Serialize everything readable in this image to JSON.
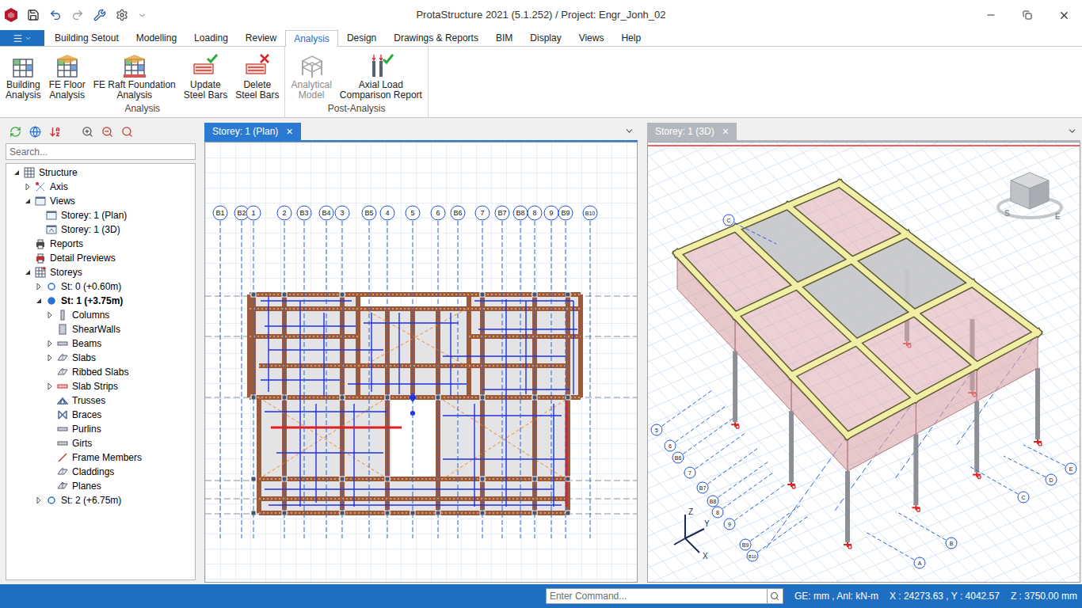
{
  "window": {
    "title": "ProtaStructure 2021 (5.1.252) / Project: Engr_Jonh_02"
  },
  "ribbon_tabs": [
    {
      "label": "Building Setout",
      "selected": false
    },
    {
      "label": "Modelling",
      "selected": false
    },
    {
      "label": "Loading",
      "selected": false
    },
    {
      "label": "Review",
      "selected": false
    },
    {
      "label": "Analysis",
      "selected": true
    },
    {
      "label": "Design",
      "selected": false
    },
    {
      "label": "Drawings & Reports",
      "selected": false
    },
    {
      "label": "BIM",
      "selected": false
    },
    {
      "label": "Display",
      "selected": false
    },
    {
      "label": "Views",
      "selected": false
    },
    {
      "label": "Help",
      "selected": false
    }
  ],
  "ribbon_groups": [
    {
      "label": "Analysis",
      "buttons": [
        {
          "lines": [
            "Building",
            "Analysis"
          ],
          "disabled": false
        },
        {
          "lines": [
            "FE Floor",
            "Analysis"
          ],
          "disabled": false
        },
        {
          "lines": [
            "FE Raft Foundation",
            "Analysis"
          ],
          "disabled": false
        },
        {
          "lines": [
            "Update",
            "Steel Bars"
          ],
          "disabled": false
        },
        {
          "lines": [
            "Delete",
            "Steel Bars"
          ],
          "disabled": false
        }
      ]
    },
    {
      "label": "Post-Analysis",
      "buttons": [
        {
          "lines": [
            "Analytical",
            "Model"
          ],
          "disabled": true
        },
        {
          "lines": [
            "Axial Load",
            "Comparison Report"
          ],
          "disabled": false
        }
      ]
    }
  ],
  "explorer": {
    "search_placeholder": "Search...",
    "tree": [
      {
        "label": "Structure",
        "depth": 0,
        "expandable": true,
        "expanded": true,
        "current": false
      },
      {
        "label": "Axis",
        "depth": 1,
        "expandable": true,
        "expanded": false,
        "current": false
      },
      {
        "label": "Views",
        "depth": 1,
        "expandable": true,
        "expanded": true,
        "current": false
      },
      {
        "label": "Storey: 1 (Plan)",
        "depth": 2,
        "expandable": false,
        "expanded": false,
        "current": false
      },
      {
        "label": "Storey: 1 (3D)",
        "depth": 2,
        "expandable": false,
        "expanded": false,
        "current": false
      },
      {
        "label": "Reports",
        "depth": 1,
        "expandable": false,
        "expanded": false,
        "current": false
      },
      {
        "label": "Detail Previews",
        "depth": 1,
        "expandable": false,
        "expanded": false,
        "current": false
      },
      {
        "label": "Storeys",
        "depth": 1,
        "expandable": true,
        "expanded": true,
        "current": false
      },
      {
        "label": "St: 0 (+0.60m)",
        "depth": 2,
        "expandable": true,
        "expanded": false,
        "current": false
      },
      {
        "label": "St: 1 (+3.75m)",
        "depth": 2,
        "expandable": true,
        "expanded": true,
        "current": true
      },
      {
        "label": "Columns",
        "depth": 3,
        "expandable": true,
        "expanded": false,
        "current": false
      },
      {
        "label": "ShearWalls",
        "depth": 3,
        "expandable": false,
        "expanded": false,
        "current": false
      },
      {
        "label": "Beams",
        "depth": 3,
        "expandable": true,
        "expanded": false,
        "current": false
      },
      {
        "label": "Slabs",
        "depth": 3,
        "expandable": true,
        "expanded": false,
        "current": false
      },
      {
        "label": "Ribbed Slabs",
        "depth": 3,
        "expandable": false,
        "expanded": false,
        "current": false
      },
      {
        "label": "Slab Strips",
        "depth": 3,
        "expandable": true,
        "expanded": false,
        "current": false
      },
      {
        "label": "Trusses",
        "depth": 3,
        "expandable": false,
        "expanded": false,
        "current": false
      },
      {
        "label": "Braces",
        "depth": 3,
        "expandable": false,
        "expanded": false,
        "current": false
      },
      {
        "label": "Purlins",
        "depth": 3,
        "expandable": false,
        "expanded": false,
        "current": false
      },
      {
        "label": "Girts",
        "depth": 3,
        "expandable": false,
        "expanded": false,
        "current": false
      },
      {
        "label": "Frame Members",
        "depth": 3,
        "expandable": false,
        "expanded": false,
        "current": false
      },
      {
        "label": "Claddings",
        "depth": 3,
        "expandable": false,
        "expanded": false,
        "current": false
      },
      {
        "label": "Planes",
        "depth": 3,
        "expandable": false,
        "expanded": false,
        "current": false
      },
      {
        "label": "St: 2 (+6.75m)",
        "depth": 2,
        "expandable": true,
        "expanded": false,
        "current": false
      }
    ]
  },
  "views": [
    {
      "tab": "Storey: 1 (Plan)",
      "close": "×",
      "selected": true,
      "kind": "plan",
      "axes": [
        "B1",
        "B2",
        "1",
        "2",
        "B3",
        "B4",
        "3",
        "B5",
        "4",
        "5",
        "6",
        "B6",
        "7",
        "B7",
        "B8",
        "8",
        "9",
        "B9",
        "B10"
      ]
    },
    {
      "tab": "Storey: 1 (3D)",
      "close": "×",
      "selected": false,
      "kind": "3d",
      "axes": [
        "5",
        "6",
        "B6",
        "7",
        "B7",
        "B8",
        "8",
        "9",
        "B9",
        "B10",
        "C",
        "B",
        "A",
        "D",
        "E",
        "C"
      ],
      "compass": [
        "S",
        "E"
      ],
      "triad": [
        "Z",
        "Y",
        "X"
      ]
    }
  ],
  "status_bar": {
    "command_placeholder": "Enter Command...",
    "units": "GE: mm , Anl: kN-m",
    "xy": "X : 24273.63 , Y : 4042.57",
    "z": "Z : 3750.00 mm"
  }
}
